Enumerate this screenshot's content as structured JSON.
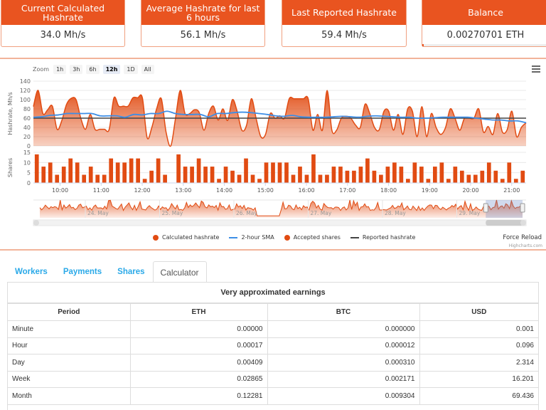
{
  "cards": [
    {
      "title": "Current Calculated Hashrate",
      "value": "34.0 Mh/s"
    },
    {
      "title": "Average Hashrate for last 6 hours",
      "value": "56.1 Mh/s"
    },
    {
      "title": "Last Reported Hashrate",
      "value": "59.4 Mh/s"
    },
    {
      "title": "Balance",
      "value": "0.00270701 ETH",
      "progress_fraction": 0.01
    }
  ],
  "chart": {
    "zoom_label": "Zoom",
    "zoom_buttons": [
      "1h",
      "3h",
      "6h",
      "12h",
      "1D",
      "All"
    ],
    "zoom_selected": "12h",
    "legend": [
      {
        "label": "Calculated hashrate",
        "type": "dot",
        "color": "#e14b12"
      },
      {
        "label": "2-hour SMA",
        "type": "line",
        "color": "#3d8ee6"
      },
      {
        "label": "Accepted shares",
        "type": "dot",
        "color": "#e14b12"
      },
      {
        "label": "Reported hashrate",
        "type": "line",
        "color": "#444444"
      }
    ],
    "force_reload": "Force Reload",
    "credits": "Highcharts.com"
  },
  "chart_data": [
    {
      "type": "area",
      "title": "",
      "ylabel": "Hashrate, Mh/s",
      "ylim": [
        0,
        140
      ],
      "yticks": [
        0,
        20,
        40,
        60,
        80,
        100,
        120,
        140
      ],
      "xticks": [
        "10:00",
        "11:00",
        "12:00",
        "13:00",
        "14:00",
        "15:00",
        "16:00",
        "17:00",
        "18:00",
        "19:00",
        "20:00",
        "21:00"
      ],
      "x_start_hour": 9.35,
      "x_end_hour": 21.35,
      "series": [
        {
          "name": "Calculated hashrate",
          "color": "#e14b12",
          "values": [
            85,
            120,
            70,
            78,
            86,
            36,
            55,
            90,
            103,
            100,
            60,
            36,
            68,
            36,
            36,
            36,
            36,
            104,
            86,
            86,
            86,
            104,
            104,
            104,
            18,
            40,
            80,
            102,
            30,
            0,
            60,
            120,
            70,
            70,
            78,
            72,
            34,
            70,
            86,
            56,
            80,
            55,
            100,
            75,
            34,
            45,
            102,
            60,
            20,
            25,
            70,
            60,
            65,
            60,
            102,
            102,
            102,
            102,
            102,
            34,
            68,
            34,
            120,
            34,
            34,
            60,
            64,
            60,
            45,
            40,
            90,
            70,
            40,
            35,
            75,
            75,
            34,
            68,
            25,
            80,
            75,
            20,
            85,
            20,
            70,
            40,
            25,
            40,
            80,
            60,
            34,
            60,
            60,
            60,
            80,
            30,
            42,
            25,
            70,
            30,
            35,
            75,
            20,
            40,
            50
          ]
        },
        {
          "name": "2-hour SMA",
          "color": "#3d8ee6",
          "values": [
            62,
            63,
            66,
            67,
            70,
            70,
            70,
            70,
            65,
            65,
            65,
            62,
            68,
            67,
            70,
            70,
            75,
            70,
            68,
            68,
            68,
            63,
            70,
            70,
            72,
            73,
            72,
            70,
            68,
            65,
            64,
            66,
            63,
            62,
            62,
            62,
            63,
            64,
            63,
            62,
            64,
            65,
            64,
            63,
            62,
            62,
            60,
            60,
            61,
            62,
            62,
            62,
            62,
            60,
            58,
            56,
            56,
            54,
            54,
            50
          ]
        },
        {
          "name": "Reported hashrate",
          "color": "#444444",
          "values": [
            60,
            60
          ]
        }
      ]
    },
    {
      "type": "bar",
      "ylabel": "Shares",
      "ylim": [
        0,
        15
      ],
      "yticks": [
        0,
        5,
        10,
        15
      ],
      "series": [
        {
          "name": "Accepted shares",
          "color": "#e14b12",
          "values": [
            14,
            8,
            10,
            4,
            8,
            12,
            10,
            4,
            8,
            4,
            4,
            12,
            10,
            10,
            12,
            12,
            2,
            6,
            12,
            4,
            0,
            14,
            8,
            8,
            12,
            8,
            8,
            2,
            8,
            6,
            4,
            12,
            4,
            2,
            10,
            10,
            10,
            10,
            4,
            8,
            4,
            14,
            4,
            4,
            8,
            8,
            6,
            6,
            8,
            12,
            6,
            4,
            8,
            10,
            8,
            2,
            10,
            8,
            2,
            8,
            10,
            2,
            8,
            6,
            4,
            4,
            6,
            10,
            6,
            2,
            10,
            2,
            6
          ]
        }
      ]
    },
    {
      "type": "area",
      "name": "navigator",
      "xticks": [
        "24. May",
        "25. May",
        "26. May",
        "27. May",
        "28. May",
        "29. May"
      ],
      "selected_range_fraction": [
        0.915,
        1.0
      ]
    }
  ],
  "tabs": [
    {
      "label": "Workers"
    },
    {
      "label": "Payments"
    },
    {
      "label": "Shares"
    },
    {
      "label": "Calculator",
      "active": true
    }
  ],
  "calculator": {
    "title": "Very approximated earnings",
    "columns": [
      "Period",
      "ETH",
      "BTC",
      "USD"
    ],
    "rows": [
      [
        "Minute",
        "0.00000",
        "0.000000",
        "0.001"
      ],
      [
        "Hour",
        "0.00017",
        "0.000012",
        "0.096"
      ],
      [
        "Day",
        "0.00409",
        "0.000310",
        "2.314"
      ],
      [
        "Week",
        "0.02865",
        "0.002171",
        "16.201"
      ],
      [
        "Month",
        "0.12281",
        "0.009304",
        "69.436"
      ]
    ]
  }
}
